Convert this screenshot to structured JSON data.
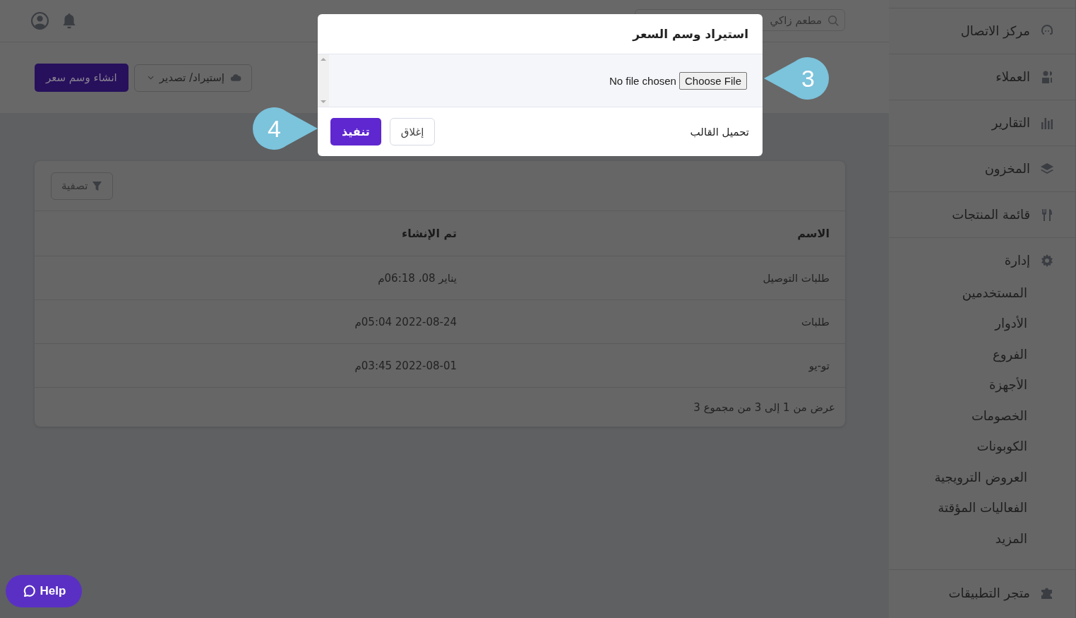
{
  "topbar": {
    "search": {
      "placeholder": "مطعم زاكي"
    }
  },
  "page": {
    "buttons": [
      {
        "label": "إستيراد/ تصدير",
        "kind": "dropdown"
      },
      {
        "label": "انشاء وسم سعر",
        "kind": "primary"
      }
    ]
  },
  "card": {
    "filter_button": "تصفية",
    "table": {
      "columns": [
        "الاسم",
        "تم الإنشاء"
      ],
      "rows": [
        [
          "طلبات التوصيل",
          "يناير 08، 06:18م"
        ],
        [
          "طلبات",
          "2022-08-24 05:04م"
        ],
        [
          "تو-يو",
          "2022-08-01 03:45م"
        ]
      ]
    },
    "pagination_info": "عرض من 1 إلى 3 من مجموع 3"
  },
  "sidebar": {
    "items": [
      {
        "label": "مركز الاتصال"
      },
      {
        "label": "العملاء"
      },
      {
        "label": "التقارير"
      },
      {
        "label": "المخزون"
      },
      {
        "label": "قائمة المنتجات"
      },
      {
        "label": "إدارة",
        "children": [
          {
            "label": "المستخدمين"
          },
          {
            "label": "الأدوار"
          },
          {
            "label": "الفروع"
          },
          {
            "label": "الأجهزة"
          },
          {
            "label": "الخصومات"
          },
          {
            "label": "الكوبونات"
          },
          {
            "label": "العروض الترويجية"
          },
          {
            "label": "الفعاليات المؤقتة"
          },
          {
            "label": "المزيد"
          }
        ]
      },
      {
        "label": "متجر التطبيقات"
      }
    ]
  },
  "modal": {
    "title": "استيراد وسم السعر",
    "file_button": "Choose File",
    "file_status": "No file chosen",
    "template_link": "تحميل القالب",
    "buttons": [
      {
        "label": "إغلاق",
        "kind": "secondary"
      },
      {
        "label": "تنفيذ",
        "kind": "primary"
      }
    ]
  },
  "callouts": [
    {
      "number": "3",
      "kind": "left"
    },
    {
      "number": "4",
      "kind": "right"
    }
  ],
  "help_button": "Help"
}
